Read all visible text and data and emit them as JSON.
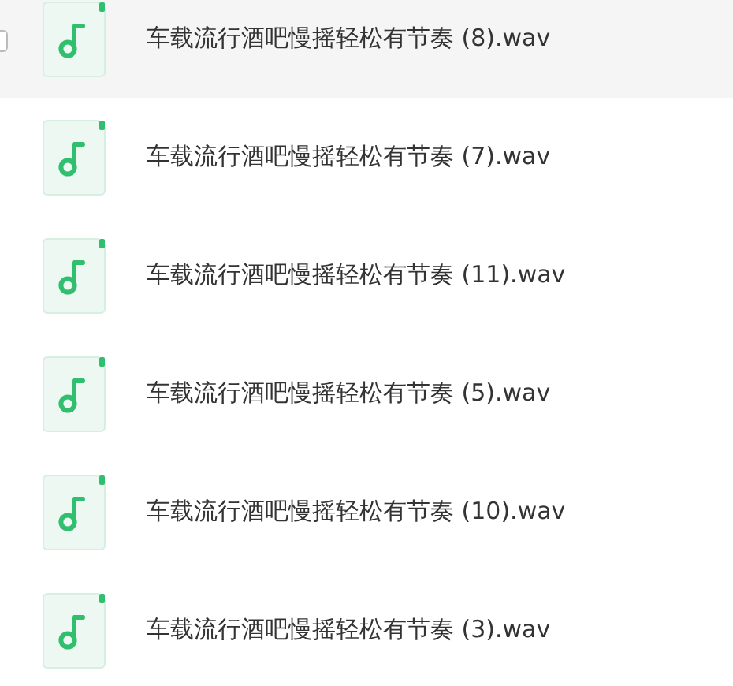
{
  "files": [
    {
      "name": "车载流行酒吧慢摇轻松有节奏 (8).wav",
      "highlighted": true,
      "checked": false
    },
    {
      "name": "车载流行酒吧慢摇轻松有节奏 (7).wav",
      "highlighted": false
    },
    {
      "name": "车载流行酒吧慢摇轻松有节奏 (11).wav",
      "highlighted": false
    },
    {
      "name": "车载流行酒吧慢摇轻松有节奏 (5).wav",
      "highlighted": false
    },
    {
      "name": "车载流行酒吧慢摇轻松有节奏 (10).wav",
      "highlighted": false
    },
    {
      "name": "车载流行酒吧慢摇轻松有节奏 (3).wav",
      "highlighted": false
    }
  ]
}
